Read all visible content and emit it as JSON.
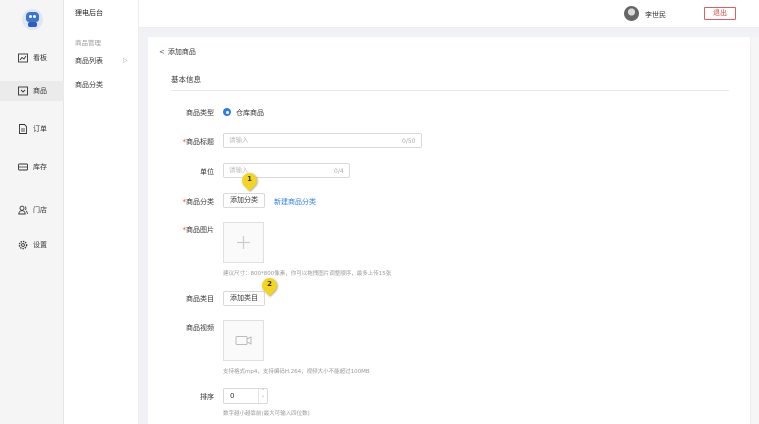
{
  "rail": {
    "items": [
      {
        "label": "看板",
        "icon": "chart-icon"
      },
      {
        "label": "商品",
        "icon": "box-icon"
      },
      {
        "label": "订单",
        "icon": "document-icon"
      },
      {
        "label": "库存",
        "icon": "warehouse-icon"
      },
      {
        "label": "门店",
        "icon": "people-icon"
      },
      {
        "label": "设置",
        "icon": "gear-icon"
      }
    ]
  },
  "subnav": {
    "title": "狸电后台",
    "group": "商品管理",
    "items": [
      "商品列表",
      "商品分类"
    ]
  },
  "header": {
    "username": "李世民",
    "logout": "退出"
  },
  "page": {
    "back": "添加商品",
    "section": "基本信息"
  },
  "form": {
    "type_label": "商品类型",
    "type_value": "仓库商品",
    "title_label": "商品标题",
    "title_placeholder": "请输入",
    "title_counter": "0/50",
    "unit_label": "单位",
    "unit_placeholder": "请输入",
    "unit_counter": "0/4",
    "category_label": "商品分类",
    "category_button": "添加分类",
    "category_link": "新建商品分类",
    "image_label": "商品图片",
    "image_hint": "建议尺寸：800*800像素，你可以拖拽图片调整顺序，最多上传15张",
    "catalog_label": "商品类目",
    "catalog_button": "添加类目",
    "video_label": "商品视频",
    "video_hint": "支持格式mp4，支持编码H.264，视频大小不能超过100MB",
    "sort_label": "排序",
    "sort_value": "0",
    "sort_hint": "数字越小越靠前(最大可输入四位数)"
  },
  "badges": [
    "1",
    "2"
  ],
  "colors": {
    "accent": "#2b7de9",
    "logout": "#e04040",
    "badge": "#f3d421"
  }
}
